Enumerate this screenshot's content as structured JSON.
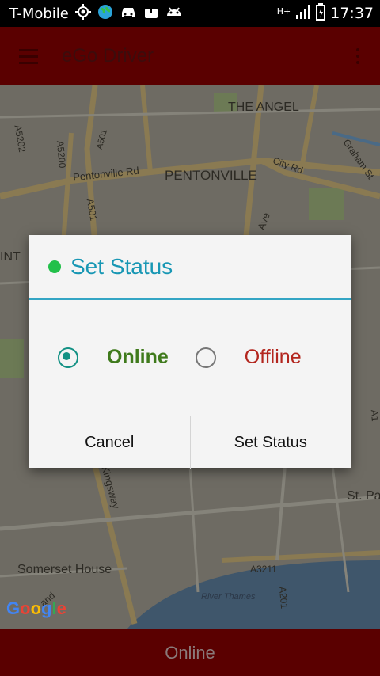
{
  "status_bar": {
    "carrier": "T-Mobile",
    "network": "H+",
    "time": "17:37"
  },
  "app_bar": {
    "title": "eGo Driver"
  },
  "map": {
    "labels": {
      "the_angel": "THE ANGEL",
      "a5202": "A5202",
      "a5200": "A5200",
      "a501_top": "A501",
      "pentonville_rd": "Pentonville Rd",
      "pentonville": "PENTONVILLE",
      "city_rd": "City Rd",
      "graham_st": "Graham St",
      "a501": "A501",
      "ave": "Ave",
      "int": "INT",
      "kingsway": "Kingsway",
      "st_pa": "St. Pa",
      "somerset_house": "Somerset House",
      "a3211": "A3211",
      "a201": "A201",
      "river_thames": "River Thames",
      "a1": "A1",
      "and": "and"
    },
    "attribution": {
      "letters": [
        "G",
        "o",
        "o",
        "g",
        "l",
        "e"
      ],
      "colors": [
        "#4285f4",
        "#ea4335",
        "#fbbc05",
        "#4285f4",
        "#34a853",
        "#ea4335"
      ]
    }
  },
  "dialog": {
    "title": "Set Status",
    "indicator_color": "#22c04a",
    "options": [
      {
        "label": "Online",
        "selected": true
      },
      {
        "label": "Offline",
        "selected": false
      }
    ],
    "cancel_label": "Cancel",
    "confirm_label": "Set Status"
  },
  "bottom_bar": {
    "status": "Online"
  }
}
